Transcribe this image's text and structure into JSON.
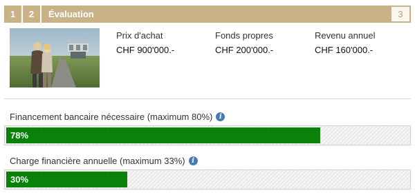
{
  "steps": {
    "step1": "1",
    "step2": "2",
    "active_label": "Évaluation",
    "step3": "3"
  },
  "summary": {
    "price_label": "Prix d'achat",
    "price_value": "CHF 900'000.-",
    "equity_label": "Fonds propres",
    "equity_value": "CHF 200'000.-",
    "income_label": "Revenu annuel",
    "income_value": "CHF 160'000.-"
  },
  "financing": {
    "title": "Financement bancaire nécessaire (maximum 80%)",
    "value_label": "78%",
    "value": 78,
    "bar_color": "#0a820a"
  },
  "charge": {
    "title": "Charge financière annuelle (maximum 33%)",
    "value_label": "30%",
    "value": 30,
    "bar_color": "#0a820a"
  },
  "icons": {
    "info": "info-icon",
    "photo": "couple-house-photo"
  },
  "colors": {
    "step_bar": "#c9b286",
    "info_icon": "#4a7ab5"
  }
}
